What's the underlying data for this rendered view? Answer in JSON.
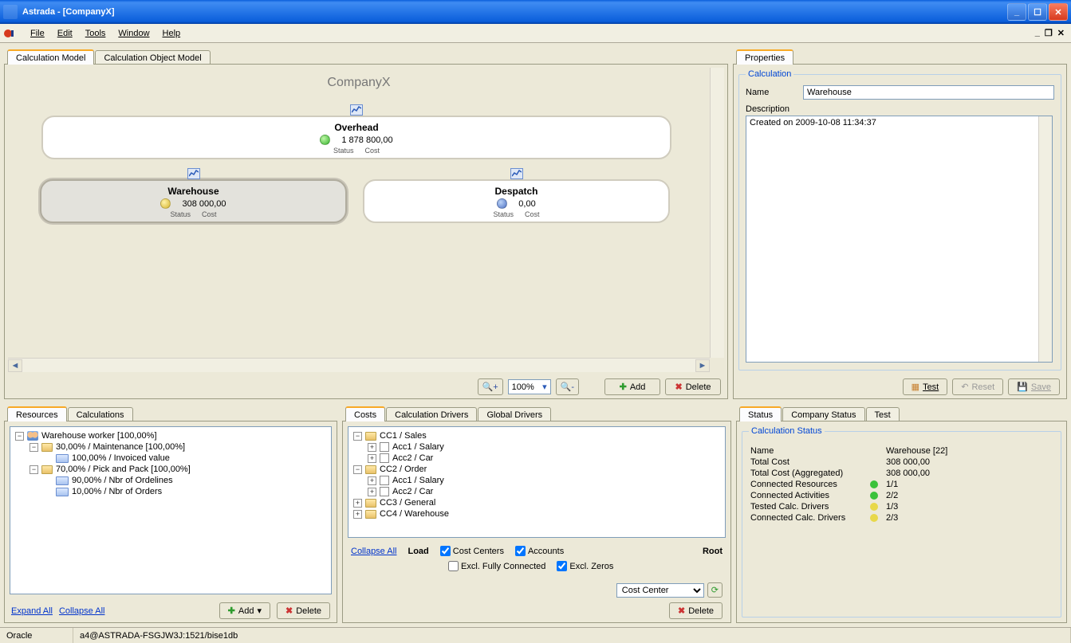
{
  "window": {
    "title": "Astrada - [CompanyX]"
  },
  "menu": {
    "file": "File",
    "edit": "Edit",
    "tools": "Tools",
    "window": "Window",
    "help": "Help"
  },
  "main_tabs": {
    "calc_model": "Calculation Model",
    "calc_obj_model": "Calculation Object Model"
  },
  "company_title": "CompanyX",
  "nodes": {
    "overhead": {
      "title": "Overhead",
      "cost": "1 878 800,00",
      "status_label": "Status",
      "cost_label": "Cost"
    },
    "warehouse": {
      "title": "Warehouse",
      "cost": "308 000,00",
      "status_label": "Status",
      "cost_label": "Cost"
    },
    "despatch": {
      "title": "Despatch",
      "cost": "0,00",
      "status_label": "Status",
      "cost_label": "Cost"
    }
  },
  "zoom": {
    "value": "100%",
    "add": "Add",
    "delete": "Delete"
  },
  "props": {
    "tab": "Properties",
    "group": "Calculation",
    "name_label": "Name",
    "name_value": "Warehouse",
    "desc_label": "Description",
    "desc_value": "Created on 2009-10-08 11:34:37",
    "btn_test": "Test",
    "btn_reset": "Reset",
    "btn_save": "Save"
  },
  "res_panel": {
    "tab_resources": "Resources",
    "tab_calculations": "Calculations",
    "tree": {
      "n0": "Warehouse worker [100,00%]",
      "n1": "30,00% / Maintenance [100,00%]",
      "n2": "100,00% / Invoiced value",
      "n3": "70,00% / Pick and Pack [100,00%]",
      "n4": "90,00% / Nbr of Ordelines",
      "n5": "10,00% / Nbr of Orders"
    },
    "expand_all": "Expand All",
    "collapse_all": "Collapse All",
    "add": "Add",
    "delete": "Delete"
  },
  "costs_panel": {
    "tab_costs": "Costs",
    "tab_cdrivers": "Calculation Drivers",
    "tab_gdrivers": "Global Drivers",
    "tree": {
      "cc1": "CC1 / Sales",
      "a1": "Acc1 / Salary",
      "a2": "Acc2 / Car",
      "cc2": "CC2 / Order",
      "b1": "Acc1 / Salary",
      "b2": "Acc2 / Car",
      "cc3": "CC3 / General",
      "cc4": "CC4 / Warehouse"
    },
    "collapse_all": "Collapse All",
    "load_label": "Load",
    "cb_costcenters": "Cost Centers",
    "cb_accounts": "Accounts",
    "cb_exclfc": "Excl. Fully Connected",
    "cb_exclzero": "Excl. Zeros",
    "root_label": "Root",
    "root_value": "Cost Center",
    "delete": "Delete"
  },
  "status_panel": {
    "tab_status": "Status",
    "tab_company": "Company Status",
    "tab_test": "Test",
    "group": "Calculation Status",
    "rows": {
      "name_l": "Name",
      "name_v": "Warehouse [22]",
      "tc_l": "Total Cost",
      "tc_v": "308 000,00",
      "tca_l": "Total Cost (Aggregated)",
      "tca_v": "308 000,00",
      "cr_l": "Connected Resources",
      "cr_v": "1/1",
      "ca_l": "Connected Activities",
      "ca_v": "2/2",
      "tcd_l": "Tested Calc. Drivers",
      "tcd_v": "1/3",
      "ccd_l": "Connected Calc. Drivers",
      "ccd_v": "2/3"
    }
  },
  "statusbar": {
    "db": "Oracle",
    "conn": "a4@ASTRADA-FSGJW3J:1521/bise1db"
  }
}
